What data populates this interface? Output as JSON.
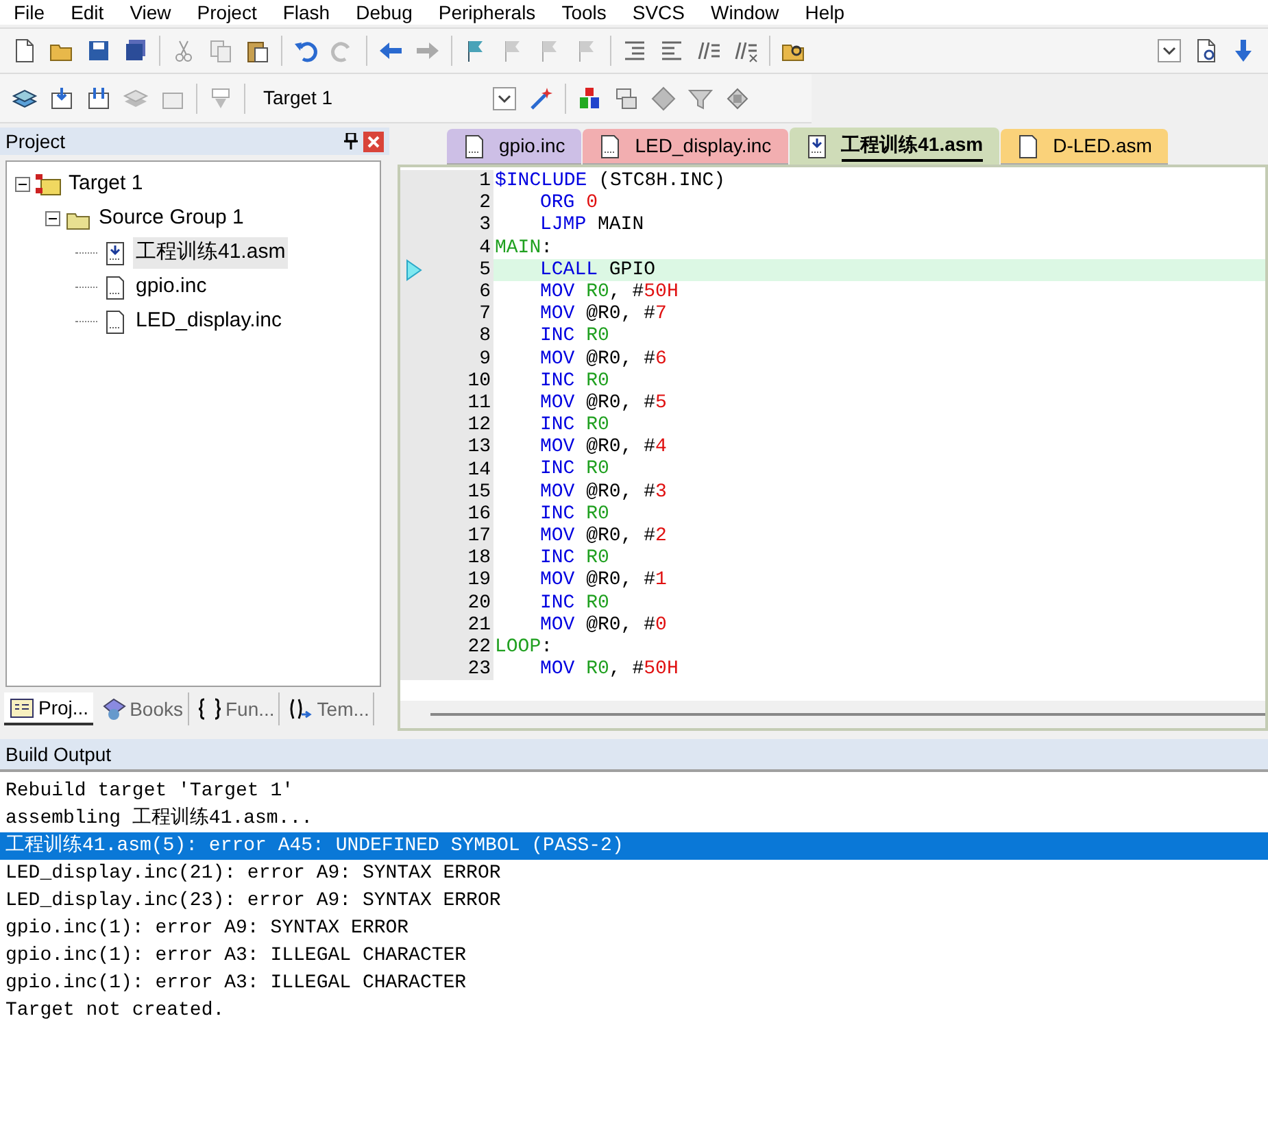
{
  "menu": [
    "File",
    "Edit",
    "View",
    "Project",
    "Flash",
    "Debug",
    "Peripherals",
    "Tools",
    "SVCS",
    "Window",
    "Help"
  ],
  "build_toolbar": {
    "target": "Target 1"
  },
  "project_panel": {
    "title": "Project",
    "tree": [
      {
        "label": "Target 1",
        "kind": "target",
        "expanded": true,
        "selected": false,
        "children": [
          {
            "label": "Source Group 1",
            "kind": "group",
            "expanded": true,
            "selected": false,
            "children": [
              {
                "label": "工程训练41.asm",
                "kind": "source",
                "selected": true
              },
              {
                "label": "gpio.inc",
                "kind": "include",
                "selected": false
              },
              {
                "label": "LED_display.inc",
                "kind": "include",
                "selected": false
              }
            ]
          }
        ]
      }
    ],
    "tabs": [
      {
        "label": "Proj...",
        "kind": "project",
        "selected": true
      },
      {
        "label": "Books",
        "kind": "books",
        "selected": false
      },
      {
        "label": "Fun...",
        "kind": "functions",
        "selected": false
      },
      {
        "label": "Tem...",
        "kind": "templates",
        "selected": false
      }
    ]
  },
  "editor": {
    "tabs": [
      {
        "label": "gpio.inc",
        "kind": "include",
        "color": "#cdbfe6",
        "selected": false
      },
      {
        "label": "LED_display.inc",
        "kind": "include",
        "color": "#f2aeb0",
        "selected": false
      },
      {
        "label": "工程训练41.asm",
        "kind": "source",
        "color": "#cfdcb8",
        "selected": true
      },
      {
        "label": "D-LED.asm",
        "kind": "plain",
        "color": "#fad27a",
        "selected": false
      }
    ],
    "lines": [
      {
        "number": "1",
        "current": false,
        "indented": false,
        "tokens": [
          {
            "kind": "keyword",
            "text": "$INCLUDE"
          },
          {
            "kind": "plain",
            "text": "(STC8H.INC)"
          }
        ]
      },
      {
        "number": "2",
        "current": false,
        "indented": true,
        "tokens": [
          {
            "kind": "keyword",
            "text": "ORG"
          },
          {
            "kind": "number",
            "text": "0"
          }
        ]
      },
      {
        "number": "3",
        "current": false,
        "indented": true,
        "tokens": [
          {
            "kind": "keyword",
            "text": "LJMP"
          },
          {
            "kind": "plain",
            "text": "MAIN"
          }
        ]
      },
      {
        "number": "4",
        "current": false,
        "indented": false,
        "tokens": [
          {
            "kind": "label",
            "text": "MAIN"
          },
          {
            "kind": "plain",
            "text": ":"
          }
        ]
      },
      {
        "number": "5",
        "current": true,
        "indented": true,
        "tokens": [
          {
            "kind": "keyword",
            "text": "LCALL"
          },
          {
            "kind": "plain",
            "text": "GPIO"
          }
        ]
      },
      {
        "number": "6",
        "current": false,
        "indented": true,
        "tokens": [
          {
            "kind": "keyword",
            "text": "MOV"
          },
          {
            "kind": "register",
            "text": "R0"
          },
          {
            "kind": "plain",
            "text": ", #"
          },
          {
            "kind": "number",
            "text": "50H"
          }
        ]
      },
      {
        "number": "7",
        "current": false,
        "indented": true,
        "tokens": [
          {
            "kind": "keyword",
            "text": "MOV"
          },
          {
            "kind": "plain",
            "text": "@R0, #"
          },
          {
            "kind": "number",
            "text": "7"
          }
        ]
      },
      {
        "number": "8",
        "current": false,
        "indented": true,
        "tokens": [
          {
            "kind": "keyword",
            "text": "INC"
          },
          {
            "kind": "register",
            "text": "R0"
          }
        ]
      },
      {
        "number": "9",
        "current": false,
        "indented": true,
        "tokens": [
          {
            "kind": "keyword",
            "text": "MOV"
          },
          {
            "kind": "plain",
            "text": "@R0, #"
          },
          {
            "kind": "number",
            "text": "6"
          }
        ]
      },
      {
        "number": "10",
        "current": false,
        "indented": true,
        "tokens": [
          {
            "kind": "keyword",
            "text": "INC"
          },
          {
            "kind": "register",
            "text": "R0"
          }
        ]
      },
      {
        "number": "11",
        "current": false,
        "indented": true,
        "tokens": [
          {
            "kind": "keyword",
            "text": "MOV"
          },
          {
            "kind": "plain",
            "text": "@R0, #"
          },
          {
            "kind": "number",
            "text": "5"
          }
        ]
      },
      {
        "number": "12",
        "current": false,
        "indented": true,
        "tokens": [
          {
            "kind": "keyword",
            "text": "INC"
          },
          {
            "kind": "register",
            "text": "R0"
          }
        ]
      },
      {
        "number": "13",
        "current": false,
        "indented": true,
        "tokens": [
          {
            "kind": "keyword",
            "text": "MOV"
          },
          {
            "kind": "plain",
            "text": "@R0, #"
          },
          {
            "kind": "number",
            "text": "4"
          }
        ]
      },
      {
        "number": "14",
        "current": false,
        "indented": true,
        "tokens": [
          {
            "kind": "keyword",
            "text": "INC"
          },
          {
            "kind": "register",
            "text": "R0"
          }
        ]
      },
      {
        "number": "15",
        "current": false,
        "indented": true,
        "tokens": [
          {
            "kind": "keyword",
            "text": "MOV"
          },
          {
            "kind": "plain",
            "text": "@R0, #"
          },
          {
            "kind": "number",
            "text": "3"
          }
        ]
      },
      {
        "number": "16",
        "current": false,
        "indented": true,
        "tokens": [
          {
            "kind": "keyword",
            "text": "INC"
          },
          {
            "kind": "register",
            "text": "R0"
          }
        ]
      },
      {
        "number": "17",
        "current": false,
        "indented": true,
        "tokens": [
          {
            "kind": "keyword",
            "text": "MOV"
          },
          {
            "kind": "plain",
            "text": "@R0, #"
          },
          {
            "kind": "number",
            "text": "2"
          }
        ]
      },
      {
        "number": "18",
        "current": false,
        "indented": true,
        "tokens": [
          {
            "kind": "keyword",
            "text": "INC"
          },
          {
            "kind": "register",
            "text": "R0"
          }
        ]
      },
      {
        "number": "19",
        "current": false,
        "indented": true,
        "tokens": [
          {
            "kind": "keyword",
            "text": "MOV"
          },
          {
            "kind": "plain",
            "text": "@R0, #"
          },
          {
            "kind": "number",
            "text": "1"
          }
        ]
      },
      {
        "number": "20",
        "current": false,
        "indented": true,
        "tokens": [
          {
            "kind": "keyword",
            "text": "INC"
          },
          {
            "kind": "register",
            "text": "R0"
          }
        ]
      },
      {
        "number": "21",
        "current": false,
        "indented": true,
        "tokens": [
          {
            "kind": "keyword",
            "text": "MOV"
          },
          {
            "kind": "plain",
            "text": "@R0, #"
          },
          {
            "kind": "number",
            "text": "0"
          }
        ]
      },
      {
        "number": "22",
        "current": false,
        "indented": false,
        "tokens": [
          {
            "kind": "label",
            "text": "LOOP"
          },
          {
            "kind": "plain",
            "text": ":"
          }
        ]
      },
      {
        "number": "23",
        "current": false,
        "indented": true,
        "tokens": [
          {
            "kind": "keyword",
            "text": "MOV"
          },
          {
            "kind": "register",
            "text": "R0"
          },
          {
            "kind": "plain",
            "text": ", #"
          },
          {
            "kind": "number",
            "text": "50H"
          }
        ]
      }
    ]
  },
  "build_output": {
    "title": "Build Output",
    "lines": [
      {
        "text": "Rebuild target 'Target 1'",
        "selected": false
      },
      {
        "text": "assembling 工程训练41.asm...",
        "selected": false
      },
      {
        "text": "工程训练41.asm(5): error A45: UNDEFINED SYMBOL (PASS-2)",
        "selected": true
      },
      {
        "text": "LED_display.inc(21): error A9: SYNTAX ERROR",
        "selected": false
      },
      {
        "text": "LED_display.inc(23): error A9: SYNTAX ERROR",
        "selected": false
      },
      {
        "text": "gpio.inc(1): error A9: SYNTAX ERROR",
        "selected": false
      },
      {
        "text": "gpio.inc(1): error A3: ILLEGAL CHARACTER",
        "selected": false
      },
      {
        "text": "gpio.inc(1): error A3: ILLEGAL CHARACTER",
        "selected": false
      },
      {
        "text": "Target not created.",
        "selected": false
      }
    ]
  }
}
